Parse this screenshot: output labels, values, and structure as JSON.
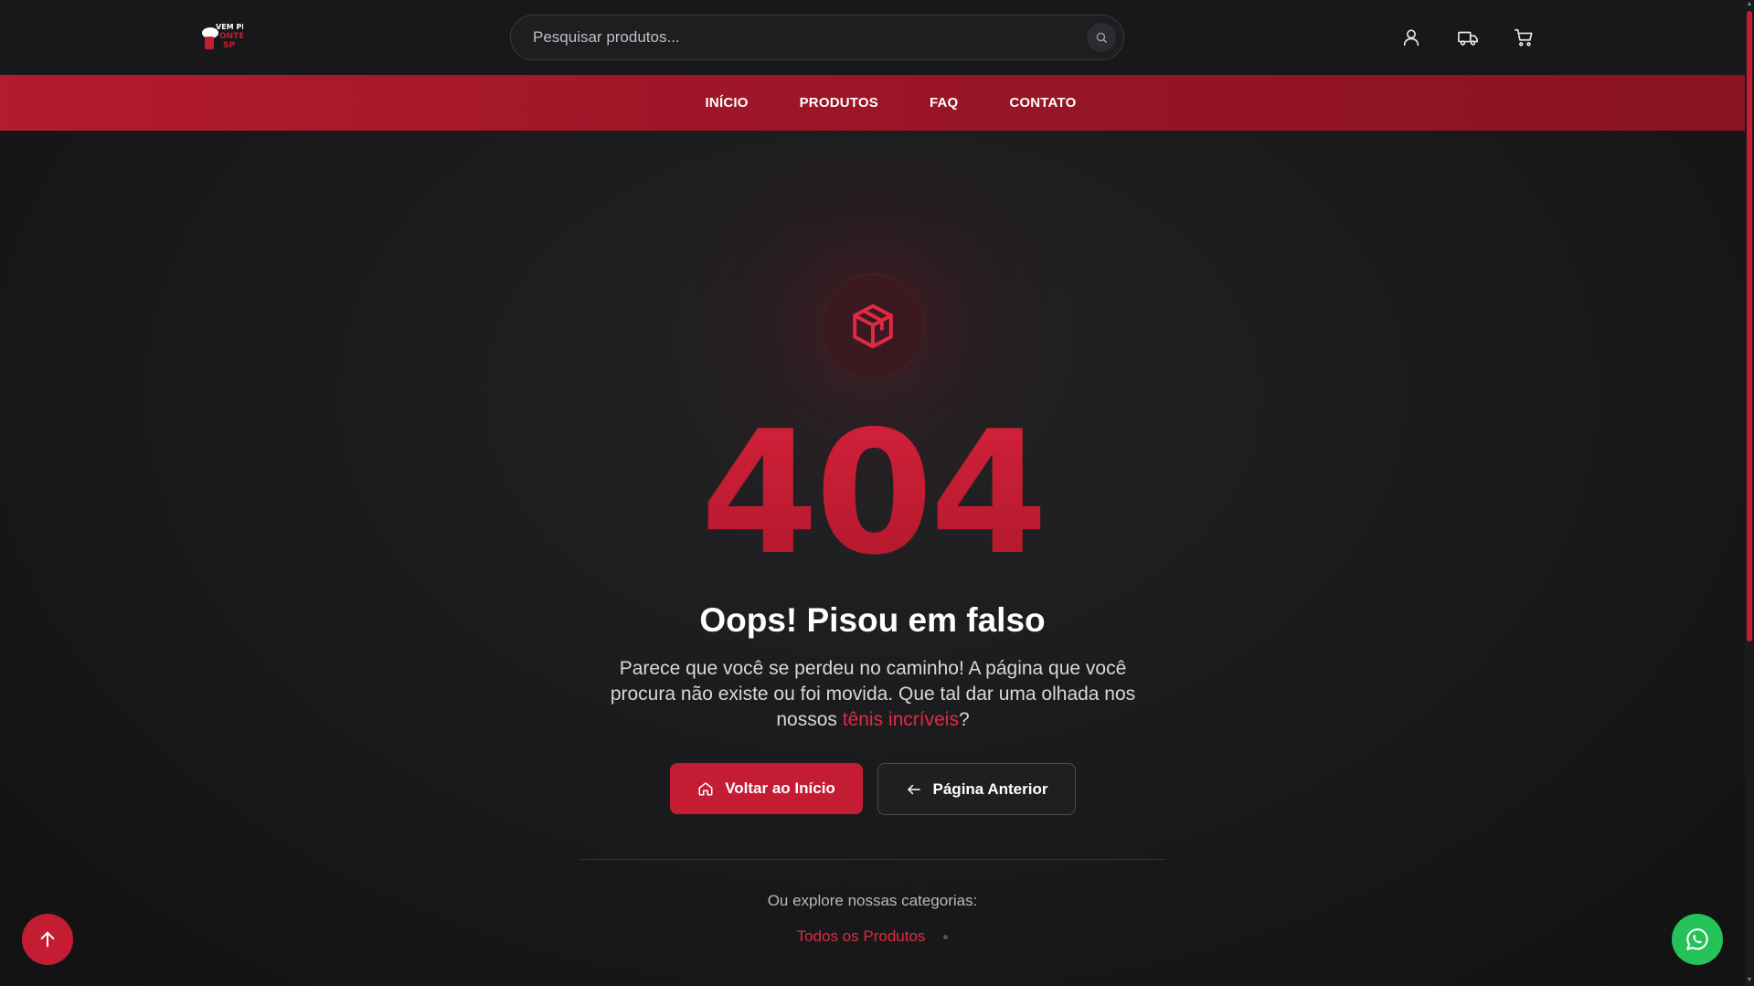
{
  "header": {
    "logo_text": "VEM PRA ONTE SP",
    "search_placeholder": "Pesquisar produtos...",
    "icons": [
      "search-icon",
      "user-icon",
      "truck-icon",
      "cart-icon"
    ]
  },
  "nav": {
    "items": [
      {
        "label": "INÍCIO"
      },
      {
        "label": "PRODUTOS"
      },
      {
        "label": "FAQ"
      },
      {
        "label": "CONTATO"
      }
    ]
  },
  "main": {
    "icon": "package-icon",
    "code": "404",
    "title": "Oops! Pisou em falso",
    "description_before": "Parece que você se perdeu no caminho! A página que você procura não existe ou foi movida. Que tal dar uma olhada nos nossos ",
    "description_link": "tênis incríveis",
    "description_after": "?",
    "primary_button": "Voltar ao Início",
    "secondary_button": "Página Anterior",
    "explore_label": "Ou explore nossas categorias:",
    "categories": [
      "Todos os Produtos"
    ]
  },
  "colors": {
    "accent": "#c41d33",
    "nav_bg": "#9a1526",
    "background": "#1a1a1c",
    "whatsapp": "#25c25a"
  }
}
